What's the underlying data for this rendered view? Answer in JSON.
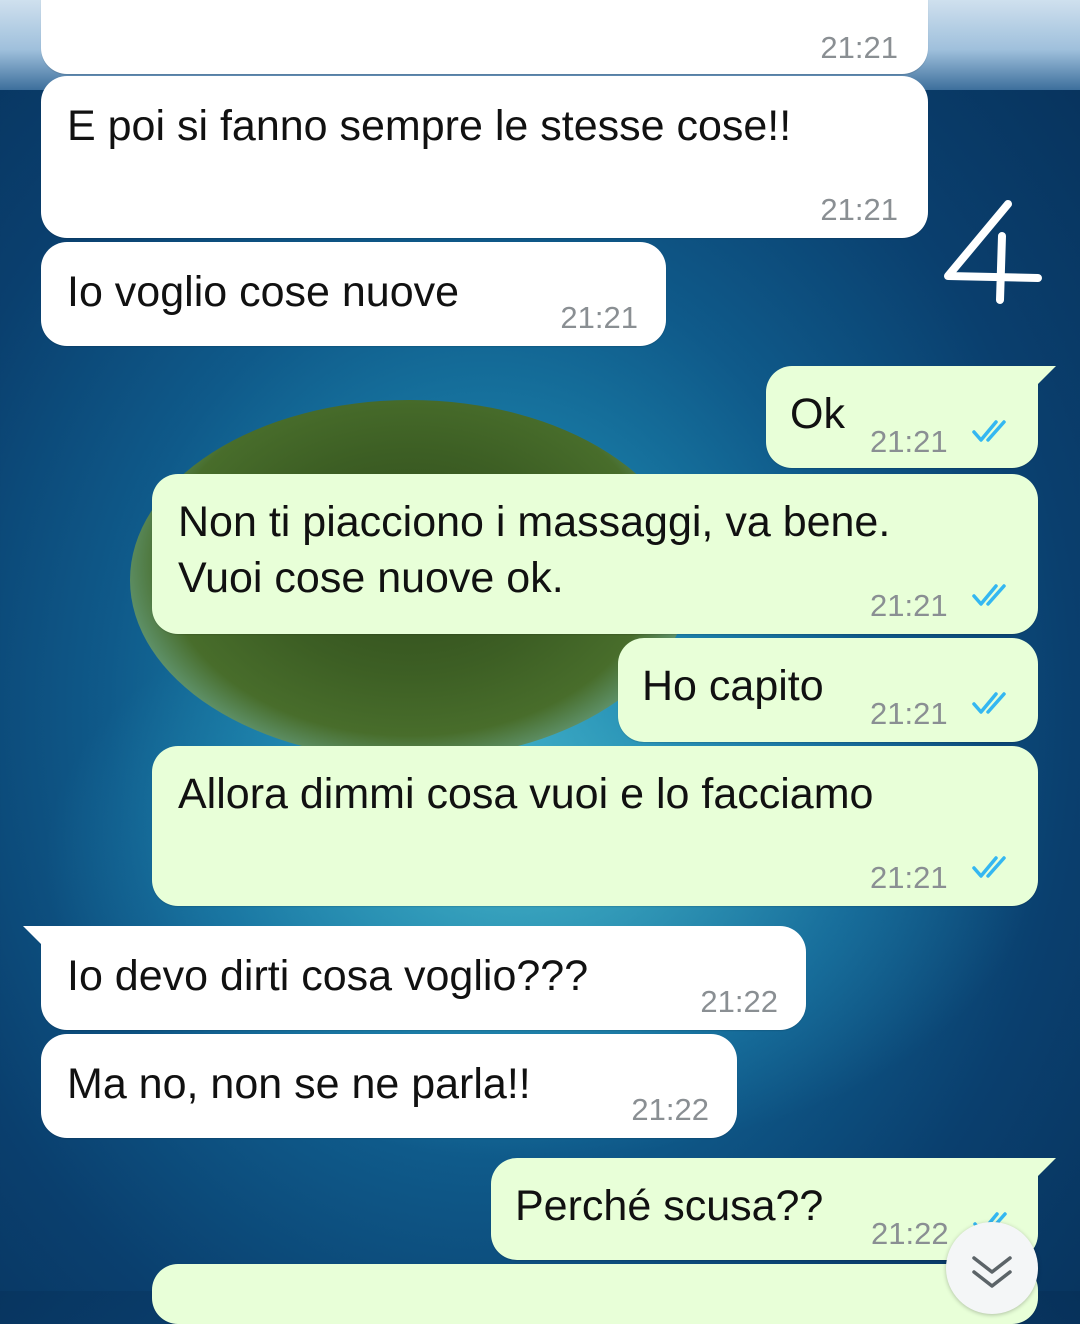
{
  "annotation": "4",
  "messages": [
    {
      "direction": "incoming",
      "text": "",
      "time": "21:21"
    },
    {
      "direction": "incoming",
      "text": "E poi si fanno sempre le stesse cose!!",
      "time": "21:21"
    },
    {
      "direction": "incoming",
      "text": "Io voglio cose nuove",
      "time": "21:21"
    },
    {
      "direction": "outgoing",
      "text": "Ok",
      "time": "21:21",
      "status": "read"
    },
    {
      "direction": "outgoing",
      "line1": "Non ti piacciono i massaggi, va bene.",
      "line2": "Vuoi cose nuove ok.",
      "time": "21:21",
      "status": "read"
    },
    {
      "direction": "outgoing",
      "text": "Ho capito",
      "time": "21:21",
      "status": "read"
    },
    {
      "direction": "outgoing",
      "text": "Allora dimmi cosa vuoi e lo facciamo",
      "time": "21:21",
      "status": "read"
    },
    {
      "direction": "incoming",
      "text": "Io devo dirti cosa voglio???",
      "time": "21:22"
    },
    {
      "direction": "incoming",
      "text": "Ma no, non se ne parla!!",
      "time": "21:22"
    },
    {
      "direction": "outgoing",
      "text": "Perché scusa??",
      "time": "21:22",
      "status": "read"
    }
  ],
  "icons": {
    "read_receipt": "double-check-icon",
    "scroll_down": "chevron-double-down-icon"
  },
  "colors": {
    "incoming_bubble": "#ffffff",
    "outgoing_bubble": "#e8ffd8",
    "read_tick": "#34b7f1",
    "timestamp": "#8a8f93"
  }
}
